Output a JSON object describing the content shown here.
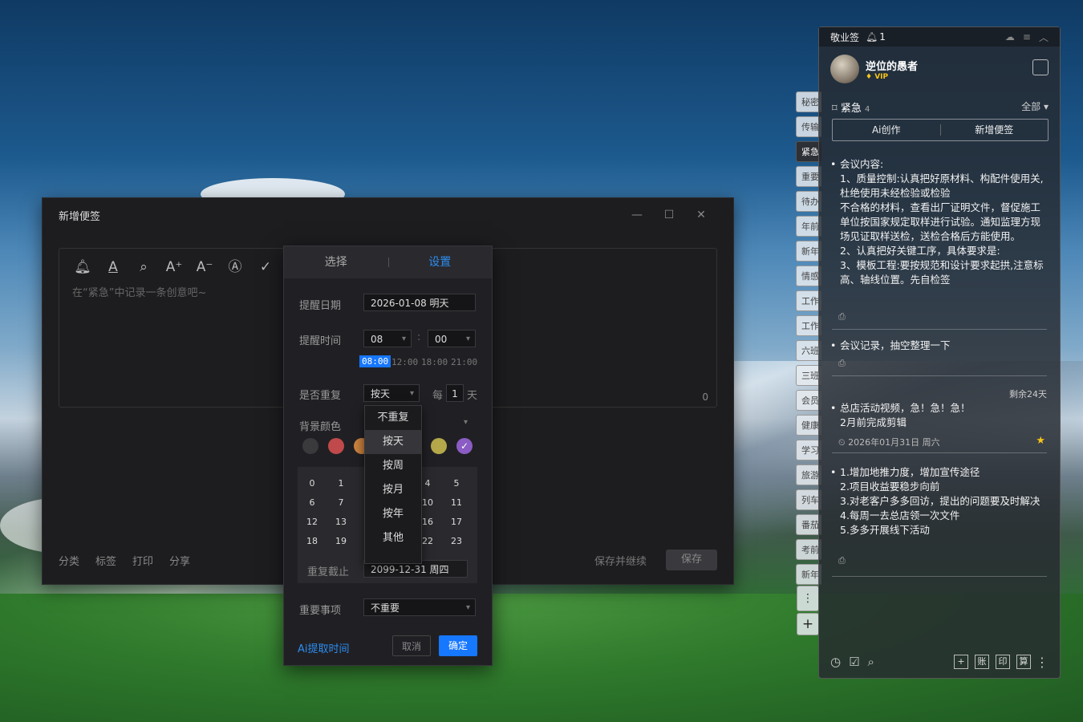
{
  "editor": {
    "title": "新增便签",
    "placeholder": "在“紧急”中记录一条创意吧~",
    "char_count": "0",
    "footer_links": [
      "分类",
      "标签",
      "打印",
      "分享"
    ],
    "save_continue": "保存并继续",
    "save": "保存"
  },
  "dialog": {
    "tabs": [
      "选择",
      "设置"
    ],
    "active_tab": "设置",
    "remind_date_label": "提醒日期",
    "remind_date_value": "2026-01-08 明天",
    "remind_time_label": "提醒时间",
    "hour": "08",
    "minute": "00",
    "time_chips": [
      "08:00",
      "12:00",
      "18:00",
      "21:00"
    ],
    "repeat_label": "是否重复",
    "repeat_value": "按天",
    "every_label": "每",
    "every_value": "1",
    "every_unit": "天",
    "bg_label": "背景颜色",
    "swatch_colors": [
      "#3a3a3c",
      "#c0494b",
      "#c9813e",
      "#2f8ee8",
      "#b5a84a",
      "#8a5cc4"
    ],
    "day_numbers": [
      "0",
      "1",
      "",
      "",
      "4",
      "5",
      "6",
      "7",
      "",
      "",
      "10",
      "11",
      "12",
      "13",
      "",
      "",
      "16",
      "17",
      "18",
      "19",
      "",
      "",
      "22",
      "23"
    ],
    "repeat_until_label": "重复截止",
    "repeat_until_value": "2099-12-31 周四",
    "importance_label": "重要事项",
    "importance_value": "不重要",
    "ai_time": "Ai提取时间",
    "cancel": "取消",
    "confirm": "确定",
    "repeat_options": [
      "不重复",
      "按天",
      "按周",
      "按月",
      "按年",
      "其他"
    ],
    "repeat_selected": "按天"
  },
  "side_tabs": [
    "秘密",
    "传输",
    "紧急",
    "重要",
    "待办",
    "年前",
    "新年",
    "情感",
    "工作",
    "工作",
    "六班",
    "三班",
    "会员",
    "健康",
    "学习",
    "旅游",
    "列车",
    "番茄",
    "考前",
    "新年"
  ],
  "side_active": "紧急",
  "panel": {
    "app_name": "敬业签",
    "bell_count": "1",
    "username": "逆位的愚者",
    "vip": "VIP",
    "category": "紧急",
    "category_count": "4",
    "filter": "全部",
    "ai_create": "Ai创作",
    "new_note": "新增便签",
    "notes": [
      {
        "text": "会议内容:\n1、质量控制:认真把好原材料、构配件使用关,杜绝使用未经检验或检验\n不合格的材料，查看出厂证明文件，督促施工单位按国家规定取样进行试验。通知监理方现场见证取样送检，送检合格后方能使用。\n2、认真把好关键工序，具体要求是:\n3、模板工程:要按规范和设计要求起拱,注意标高、轴线位置。先自检签"
      },
      {
        "text": "会议记录，抽空整理一下"
      },
      {
        "text": "总店活动视频，急！急！急！\n2月前完成剪辑",
        "remaining": "剩余24天",
        "date": "2026年01月31日 周六"
      },
      {
        "text": "1.增加地推力度，增加宣传途径\n2.项目收益要稳步向前\n3.对老客户多多回访，提出的问题要及时解决\n4.每周一去总店领一次文件\n5.多多开展线下活动"
      }
    ],
    "bottom_buttons": [
      "账",
      "印",
      "算"
    ]
  }
}
